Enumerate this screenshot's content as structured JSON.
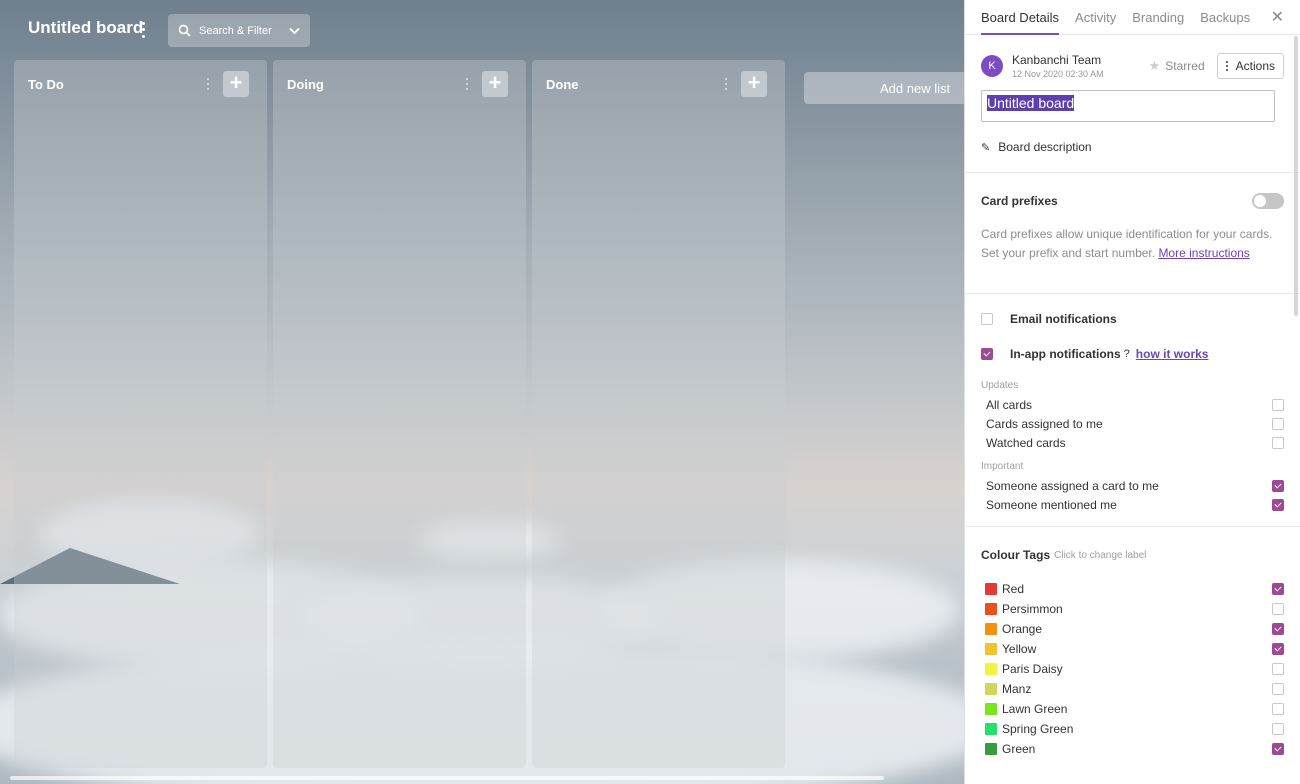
{
  "board": {
    "title": "Untitled board",
    "search_label": "Search & Filter",
    "add_list_label": "Add new list",
    "lists": [
      {
        "title": "To Do"
      },
      {
        "title": "Doing"
      },
      {
        "title": "Done"
      }
    ]
  },
  "panel": {
    "tabs": [
      {
        "label": "Board Details",
        "active": true
      },
      {
        "label": "Activity"
      },
      {
        "label": "Branding"
      },
      {
        "label": "Backups"
      }
    ],
    "close_glyph": "✕",
    "team": {
      "avatar_letter": "K",
      "name": "Kanbanchi Team",
      "date": "12 Nov 2020 02:30 AM",
      "starred_label": "Starred",
      "actions_label": "Actions"
    },
    "title_value": "Untitled board",
    "description_label": "Board description",
    "card_prefixes": {
      "heading": "Card prefixes",
      "text": "Card prefixes allow unique identification for your cards. Set your prefix and start number.",
      "link": "More instructions",
      "enabled": false
    },
    "notifications": {
      "email_label": "Email notifications",
      "inapp_label": "In-app notifications",
      "inapp_link": "how it works",
      "updates_label": "Updates",
      "updates": [
        {
          "label": "All cards",
          "checked": false
        },
        {
          "label": "Cards assigned to me",
          "checked": false
        },
        {
          "label": "Watched cards",
          "checked": false
        }
      ],
      "important_label": "Important",
      "important": [
        {
          "label": "Someone assigned a card to me",
          "checked": true
        },
        {
          "label": "Someone mentioned me",
          "checked": true
        }
      ]
    },
    "colour_tags": {
      "heading": "Colour Tags",
      "hint": "Click to change label",
      "tags": [
        {
          "label": "Red",
          "color": "#e53935",
          "checked": true
        },
        {
          "label": "Persimmon",
          "color": "#e8501e",
          "checked": false
        },
        {
          "label": "Orange",
          "color": "#f4900c",
          "checked": true
        },
        {
          "label": "Yellow",
          "color": "#f2c230",
          "checked": true
        },
        {
          "label": "Paris Daisy",
          "color": "#eef441",
          "checked": false
        },
        {
          "label": "Manz",
          "color": "#cdd95a",
          "checked": false
        },
        {
          "label": "Lawn Green",
          "color": "#7be421",
          "checked": false
        },
        {
          "label": "Spring Green",
          "color": "#22e06a",
          "checked": false
        },
        {
          "label": "Green",
          "color": "#3a9a44",
          "checked": true
        }
      ]
    }
  }
}
